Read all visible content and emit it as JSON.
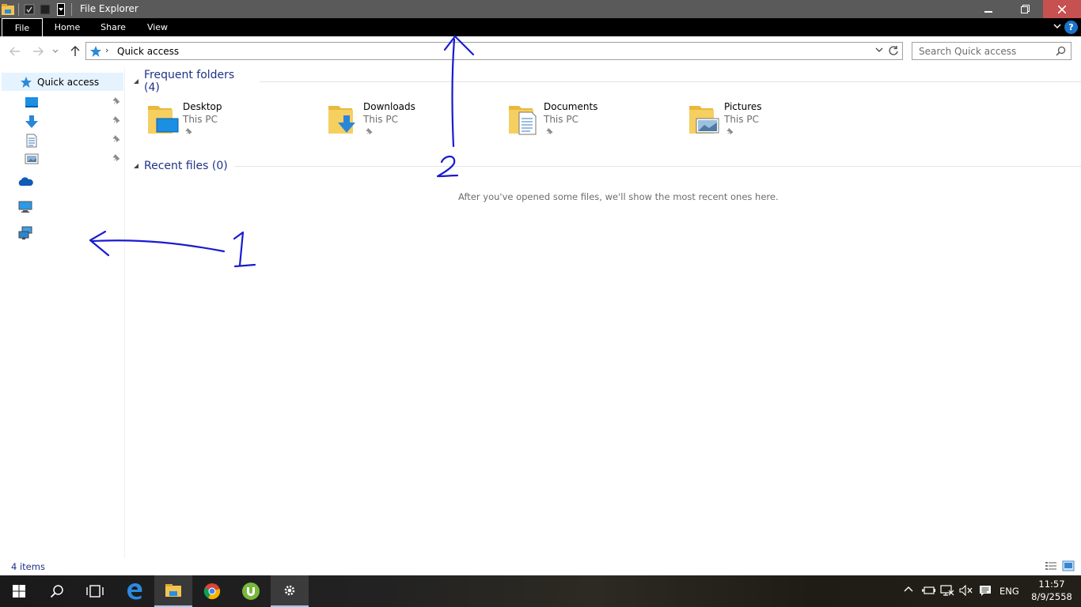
{
  "window": {
    "title": "File Explorer",
    "controls": {
      "minimize": "minimize",
      "maximize": "restore",
      "close": "close"
    }
  },
  "ribbon": {
    "tabs": [
      "File",
      "Home",
      "Share",
      "View"
    ]
  },
  "address_bar": {
    "breadcrumb": "Quick access"
  },
  "search": {
    "placeholder": "Search Quick access"
  },
  "nav_pane": {
    "quick_access_label": "Quick access",
    "pinned_icons": [
      "desktop-icon",
      "downloads-icon",
      "documents-icon",
      "pictures-icon"
    ],
    "other_icons": [
      "onedrive-icon",
      "this-pc-icon",
      "network-icon"
    ]
  },
  "content": {
    "frequent_folders": {
      "title": "Frequent folders (4)",
      "items": [
        {
          "name": "Desktop",
          "location": "This PC",
          "icon": "desktop-folder-icon"
        },
        {
          "name": "Downloads",
          "location": "This PC",
          "icon": "downloads-folder-icon"
        },
        {
          "name": "Documents",
          "location": "This PC",
          "icon": "documents-folder-icon"
        },
        {
          "name": "Pictures",
          "location": "This PC",
          "icon": "pictures-folder-icon"
        }
      ]
    },
    "recent_files": {
      "title": "Recent files (0)",
      "empty_message": "After you've opened some files, we'll show the most recent ones here."
    }
  },
  "annotations": {
    "label_1": "1",
    "label_2": "2",
    "color": "#1a1ad0"
  },
  "status_bar": {
    "item_count": "4 items"
  },
  "taskbar": {
    "apps": [
      "start-icon",
      "search-icon",
      "task-view-icon",
      "edge-icon",
      "file-explorer-icon",
      "chrome-icon",
      "utorrent-icon",
      "settings-icon"
    ],
    "language": "ENG",
    "time": "11:57",
    "date": "8/9/2558"
  },
  "colors": {
    "accent": "#0078d7",
    "selection": "#e5f3ff",
    "heading": "#1e3287",
    "titlebar": "#5a5a5a"
  }
}
